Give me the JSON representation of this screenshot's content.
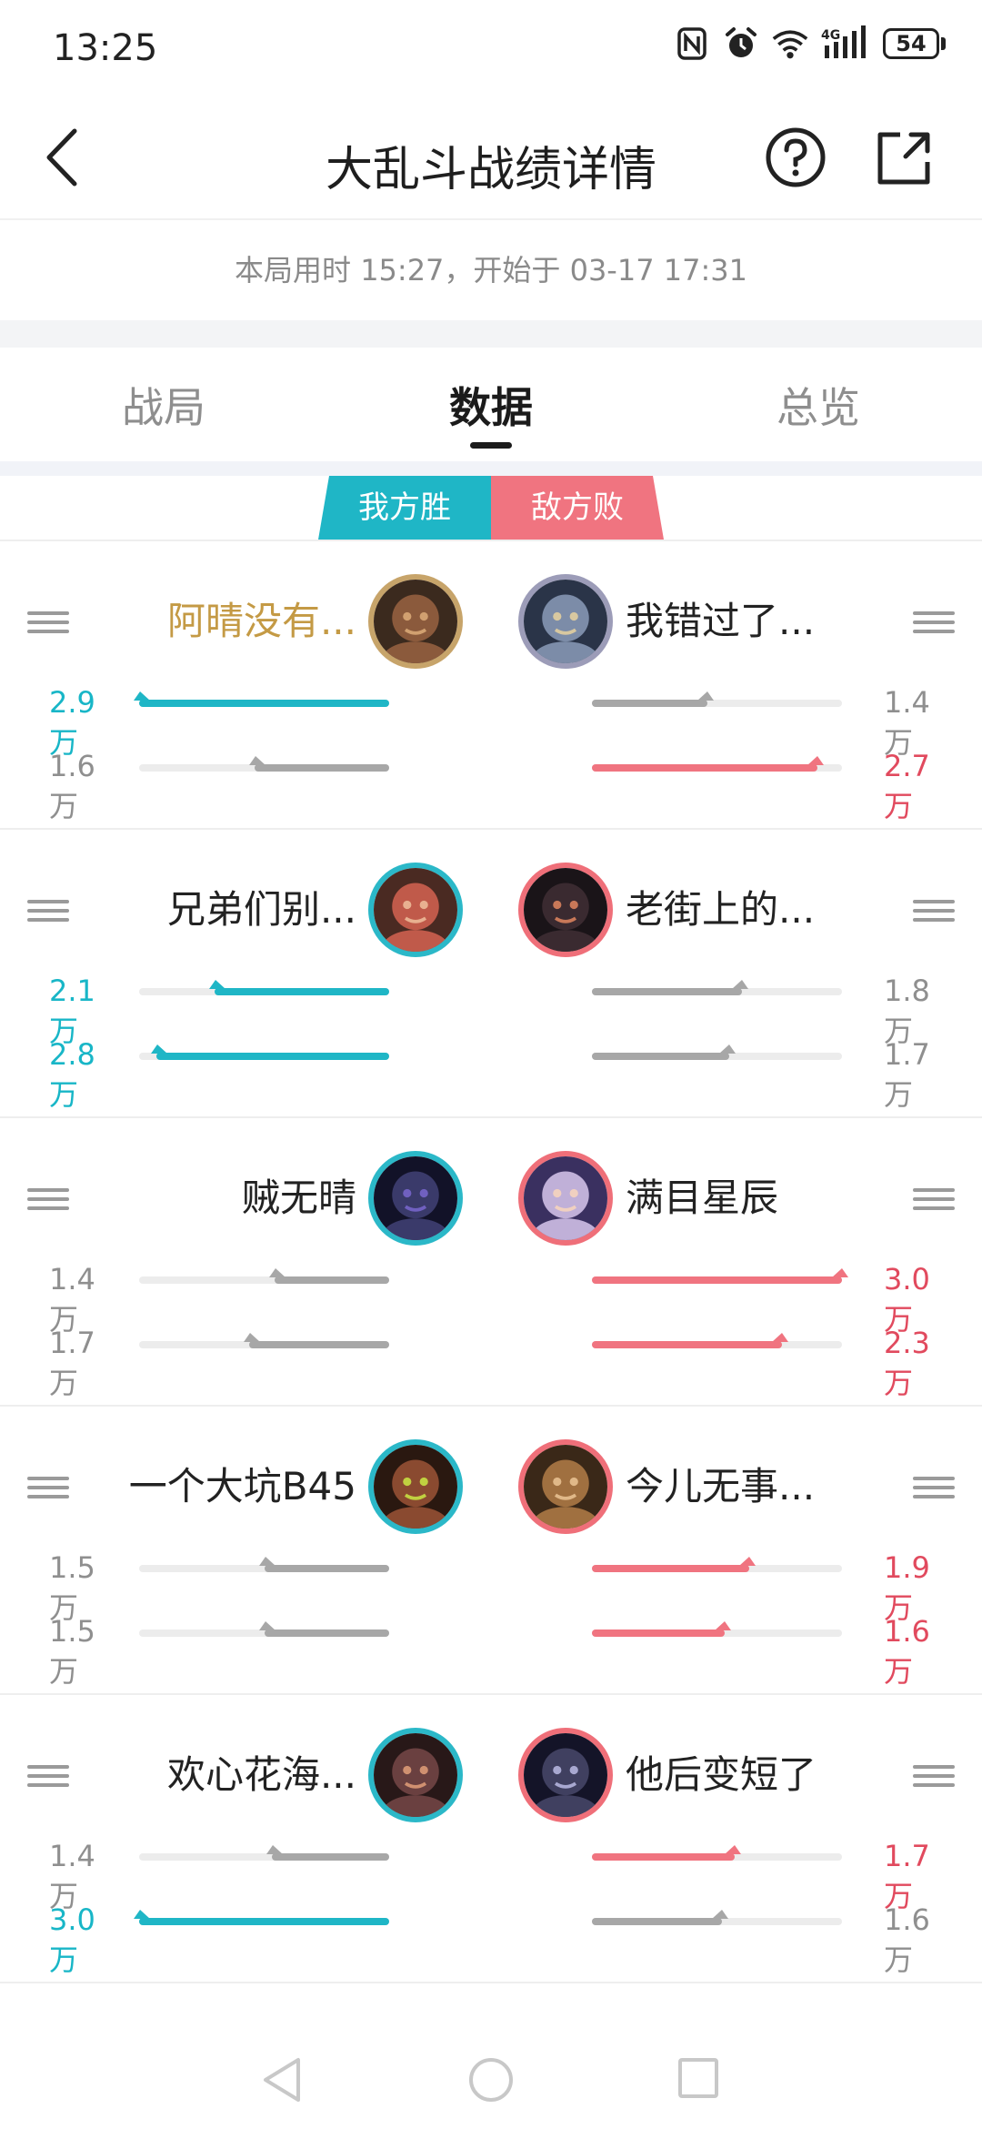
{
  "status_bar": {
    "time": "13:25",
    "battery": "54",
    "icons": [
      "nfc-icon",
      "alarm-icon",
      "wifi-icon",
      "4g-signal-icon",
      "battery-icon"
    ]
  },
  "header": {
    "title": "大乱斗战绩详情",
    "back_icon": "chevron-left-icon",
    "help_icon": "question-circle-icon",
    "share_icon": "share-external-icon"
  },
  "match_info": "本局用时 15:27，开始于 03-17 17:31",
  "tabs": [
    {
      "label": "战局",
      "active": false
    },
    {
      "label": "数据",
      "active": true
    },
    {
      "label": "总览",
      "active": false
    }
  ],
  "result": {
    "our": "我方胜",
    "enemy": "敌方败",
    "our_color": "#1fb6c6",
    "enemy_color": "#f07480"
  },
  "players": [
    {
      "left": {
        "name": "阿晴没有...",
        "ring": "gold",
        "name_color": "gold",
        "stat1": "2.9万",
        "stat1_color": "cyan",
        "frac1": 1.0,
        "stat2": "1.6万",
        "stat2_color": "gray",
        "frac2": 0.54
      },
      "right": {
        "name": "我错过了...",
        "ring": "silver",
        "stat1": "1.4万",
        "stat1_color": "gray",
        "frac1": 0.46,
        "stat2": "2.7万",
        "stat2_color": "red",
        "frac2": 0.9
      }
    },
    {
      "left": {
        "name": "兄弟们别...",
        "ring": "cyan",
        "stat1": "2.1万",
        "stat1_color": "cyan",
        "frac1": 0.7,
        "stat2": "2.8万",
        "stat2_color": "cyan",
        "frac2": 0.93
      },
      "right": {
        "name": "老街上的...",
        "ring": "red",
        "stat1": "1.8万",
        "stat1_color": "gray",
        "frac1": 0.6,
        "stat2": "1.7万",
        "stat2_color": "gray",
        "frac2": 0.55
      }
    },
    {
      "left": {
        "name": "贼无晴",
        "ring": "cyan",
        "stat1": "1.4万",
        "stat1_color": "gray",
        "frac1": 0.46,
        "stat2": "1.7万",
        "stat2_color": "gray",
        "frac2": 0.56
      },
      "right": {
        "name": "满目星辰",
        "ring": "red",
        "stat1": "3.0万",
        "stat1_color": "red",
        "frac1": 1.0,
        "stat2": "2.3万",
        "stat2_color": "red",
        "frac2": 0.76
      }
    },
    {
      "left": {
        "name": "一个大坑B45",
        "ring": "cyan",
        "stat1": "1.5万",
        "stat1_color": "gray",
        "frac1": 0.5,
        "stat2": "1.5万",
        "stat2_color": "gray",
        "frac2": 0.5
      },
      "right": {
        "name": "今儿无事...",
        "ring": "red",
        "stat1": "1.9万",
        "stat1_color": "red",
        "frac1": 0.63,
        "stat2": "1.6万",
        "stat2_color": "red",
        "frac2": 0.53
      }
    },
    {
      "left": {
        "name": "欢心花海...",
        "ring": "cyan",
        "stat1": "1.4万",
        "stat1_color": "gray",
        "frac1": 0.47,
        "stat2": "3.0万",
        "stat2_color": "cyan",
        "frac2": 1.0
      },
      "right": {
        "name": "他后变短了",
        "ring": "red",
        "stat1": "1.7万",
        "stat1_color": "red",
        "frac1": 0.57,
        "stat2": "1.6万",
        "stat2_color": "gray",
        "frac2": 0.52
      }
    }
  ],
  "bottom_nav": [
    "back-triangle-icon",
    "home-circle-icon",
    "recents-square-icon"
  ]
}
